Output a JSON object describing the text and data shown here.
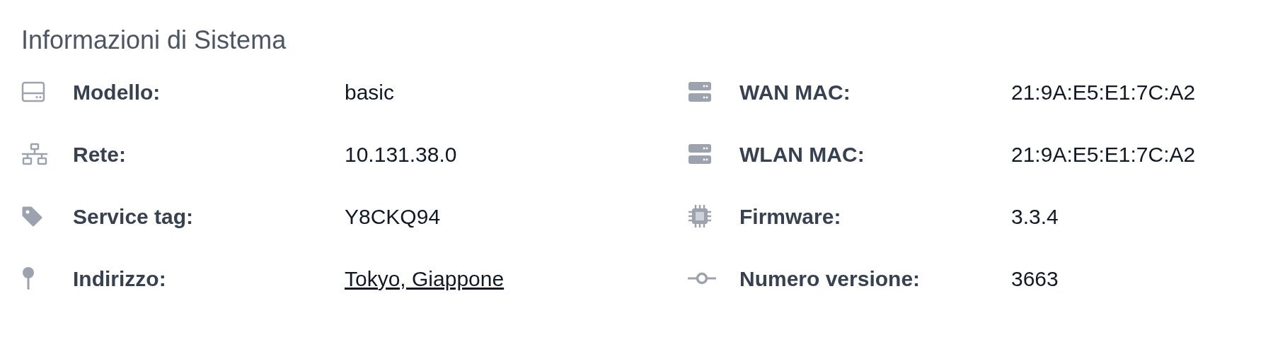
{
  "title": "Informazioni di Sistema",
  "columns": [
    {
      "rows": [
        {
          "label": "Modello:",
          "value": "basic",
          "kind": "text"
        },
        {
          "label": "Rete:",
          "value": "10.131.38.0",
          "kind": "text"
        },
        {
          "label": "Service tag:",
          "value": "Y8CKQ94",
          "kind": "text"
        },
        {
          "label": "Indirizzo:",
          "value": "Tokyo, Giappone",
          "kind": "link"
        }
      ]
    },
    {
      "rows": [
        {
          "label": "WAN MAC:",
          "value": "21:9A:E5:E1:7C:A2",
          "kind": "text"
        },
        {
          "label": "WLAN MAC:",
          "value": "21:9A:E5:E1:7C:A2",
          "kind": "text"
        },
        {
          "label": "Firmware:",
          "value": "3.3.4",
          "kind": "text"
        },
        {
          "label": "Numero versione:",
          "value": "3663",
          "kind": "text"
        }
      ]
    }
  ]
}
